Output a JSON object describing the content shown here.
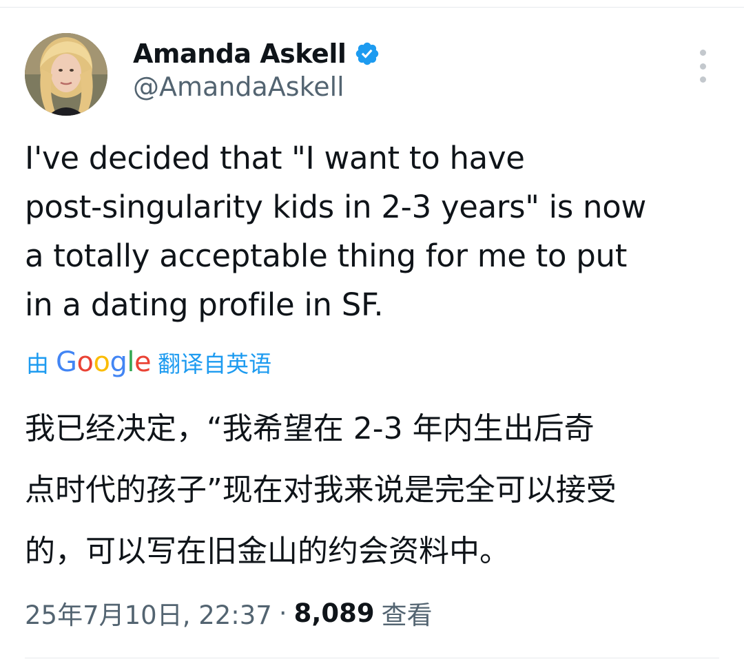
{
  "author": {
    "display_name": "Amanda Askell",
    "handle": "@AmandaAskell",
    "verified": true,
    "avatar_icon": "profile-photo",
    "verified_icon": "verified-badge-icon",
    "badge_color": "#1d9bf0"
  },
  "menu": {
    "icon": "more-vertical-icon"
  },
  "tweet": {
    "text_lines": [
      "I've decided that \"I want to have",
      "post-singularity kids in 2-3 years\" is now",
      "a totally acceptable thing for me to put",
      "in a dating profile in SF."
    ]
  },
  "translation": {
    "prefix": "由",
    "provider_letters": [
      "G",
      "o",
      "o",
      "g",
      "l",
      "e"
    ],
    "suffix": "翻译自英语",
    "link_color": "#1d9bf0",
    "text_lines": [
      "我已经决定，“我希望在 2-3 年内生出后奇",
      "点时代的孩子”现在对我来说是完全可以接受",
      "的，可以写在旧金山的约会资料中。"
    ]
  },
  "meta": {
    "timestamp": "25年7月10日, 22:37",
    "separator": "·",
    "view_count": "8,089",
    "views_label": "查看"
  }
}
